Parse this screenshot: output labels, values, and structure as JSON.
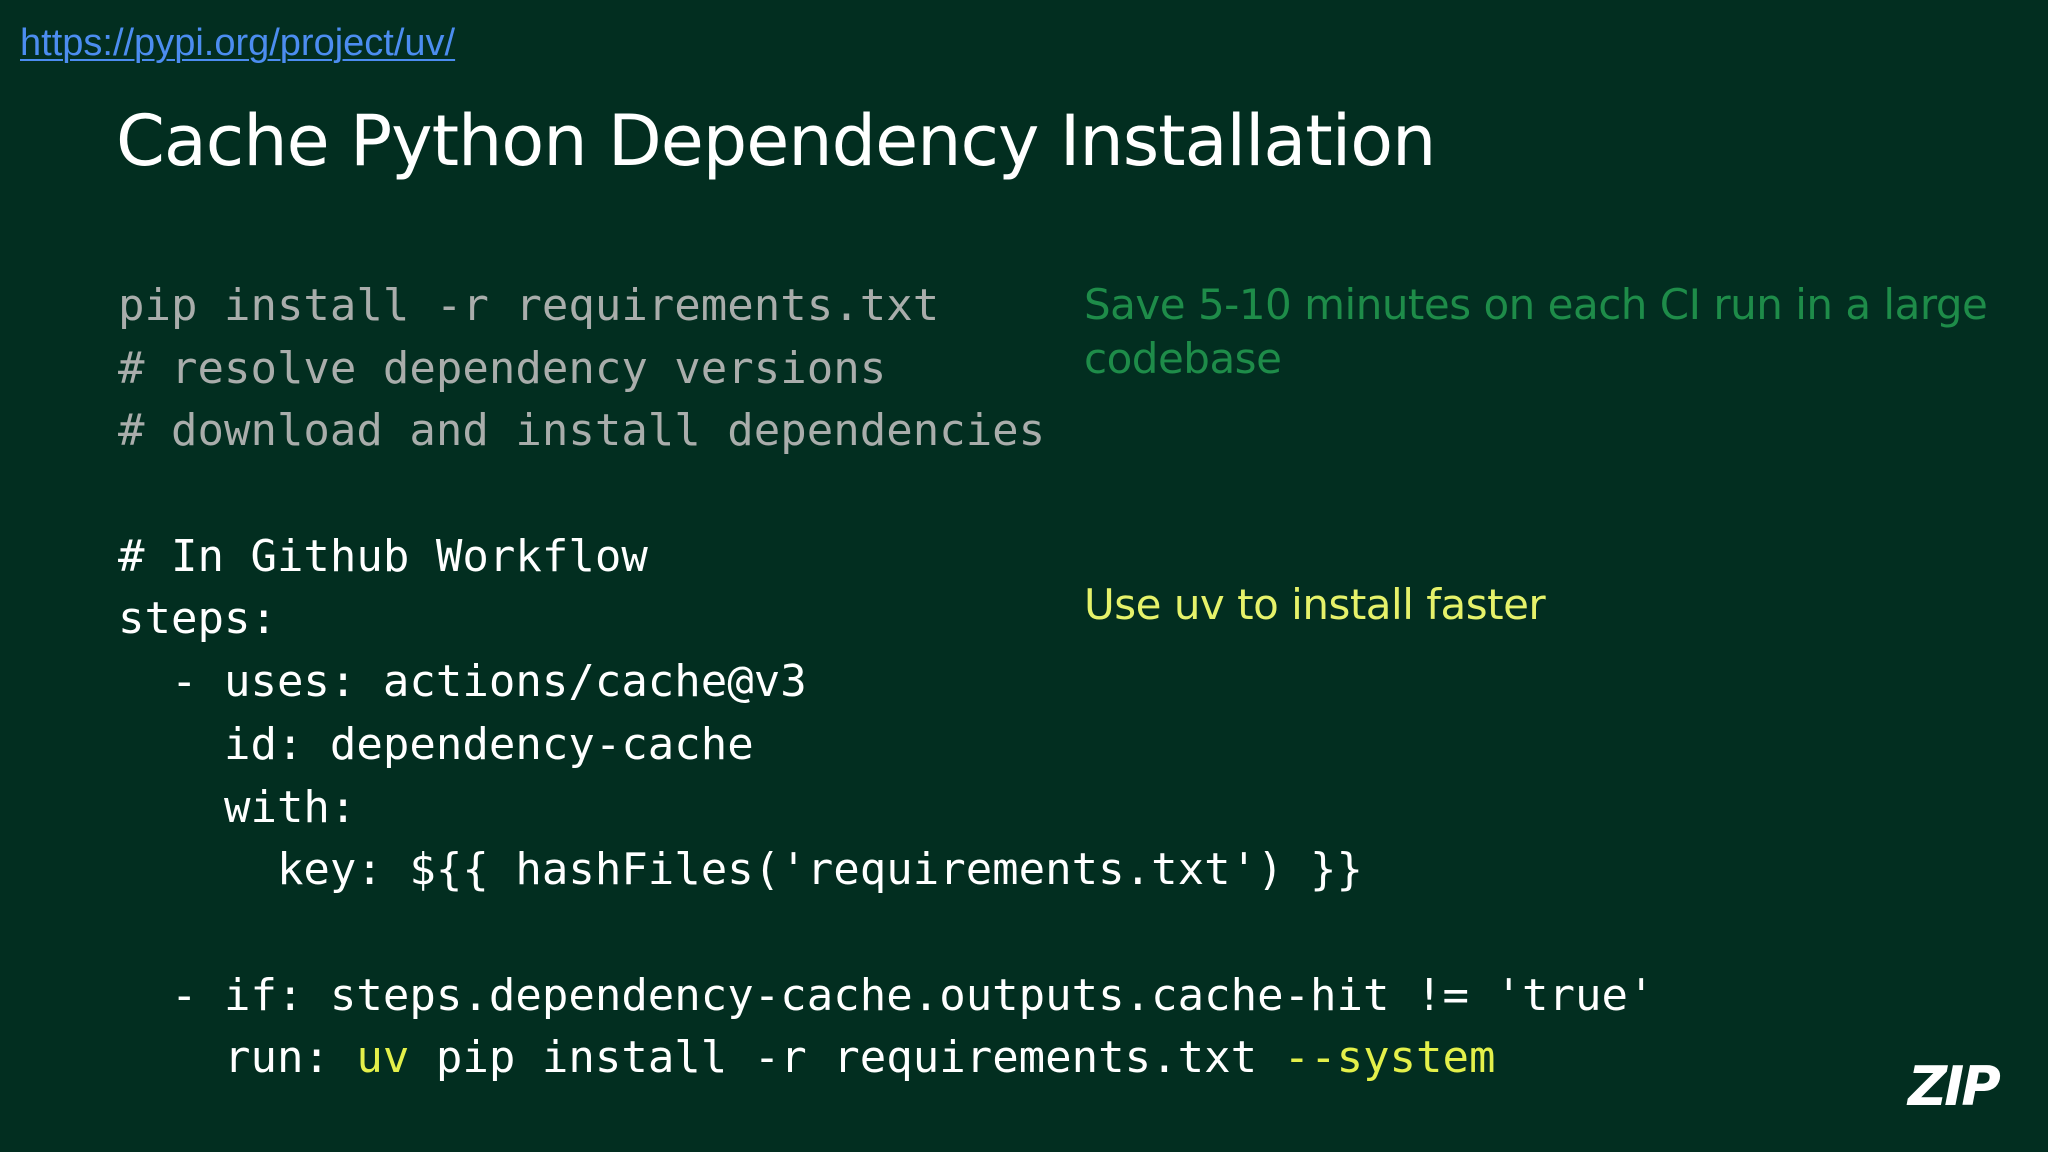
{
  "header": {
    "url": "https://pypi.org/project/uv/",
    "title": "Cache Python Dependency Installation"
  },
  "code": {
    "line1": "pip install -r requirements.txt",
    "line2": "# resolve dependency versions",
    "line3": "# download and install dependencies",
    "line4": "",
    "line5": "# In Github Workflow",
    "line6": "steps:",
    "line7": "  - uses: actions/cache@v3",
    "line8": "    id: dependency-cache",
    "line9": "    with:",
    "line10": "      key: ${{ hashFiles('requirements.txt') }}",
    "line11": "",
    "line12": "  - if: steps.dependency-cache.outputs.cache-hit != 'true'",
    "line13_indent": "    run: ",
    "line13_uv": "uv",
    "line13_mid": " pip install -r requirements.txt ",
    "line13_flag": "--system"
  },
  "notes": {
    "green": "Save 5-10 minutes on each CI run in a large codebase",
    "yellow": "Use uv to install faster"
  },
  "logo": {
    "text": "ZIP"
  },
  "colors": {
    "background": "#022E20",
    "title": "#FFFFFF",
    "link": "#4C8DF0",
    "code_dim": "#A9ADAB",
    "code_main": "#FFFFFF",
    "highlight": "#E4F04A",
    "note_green": "#1E8C49",
    "note_yellow": "#E6F26A"
  }
}
